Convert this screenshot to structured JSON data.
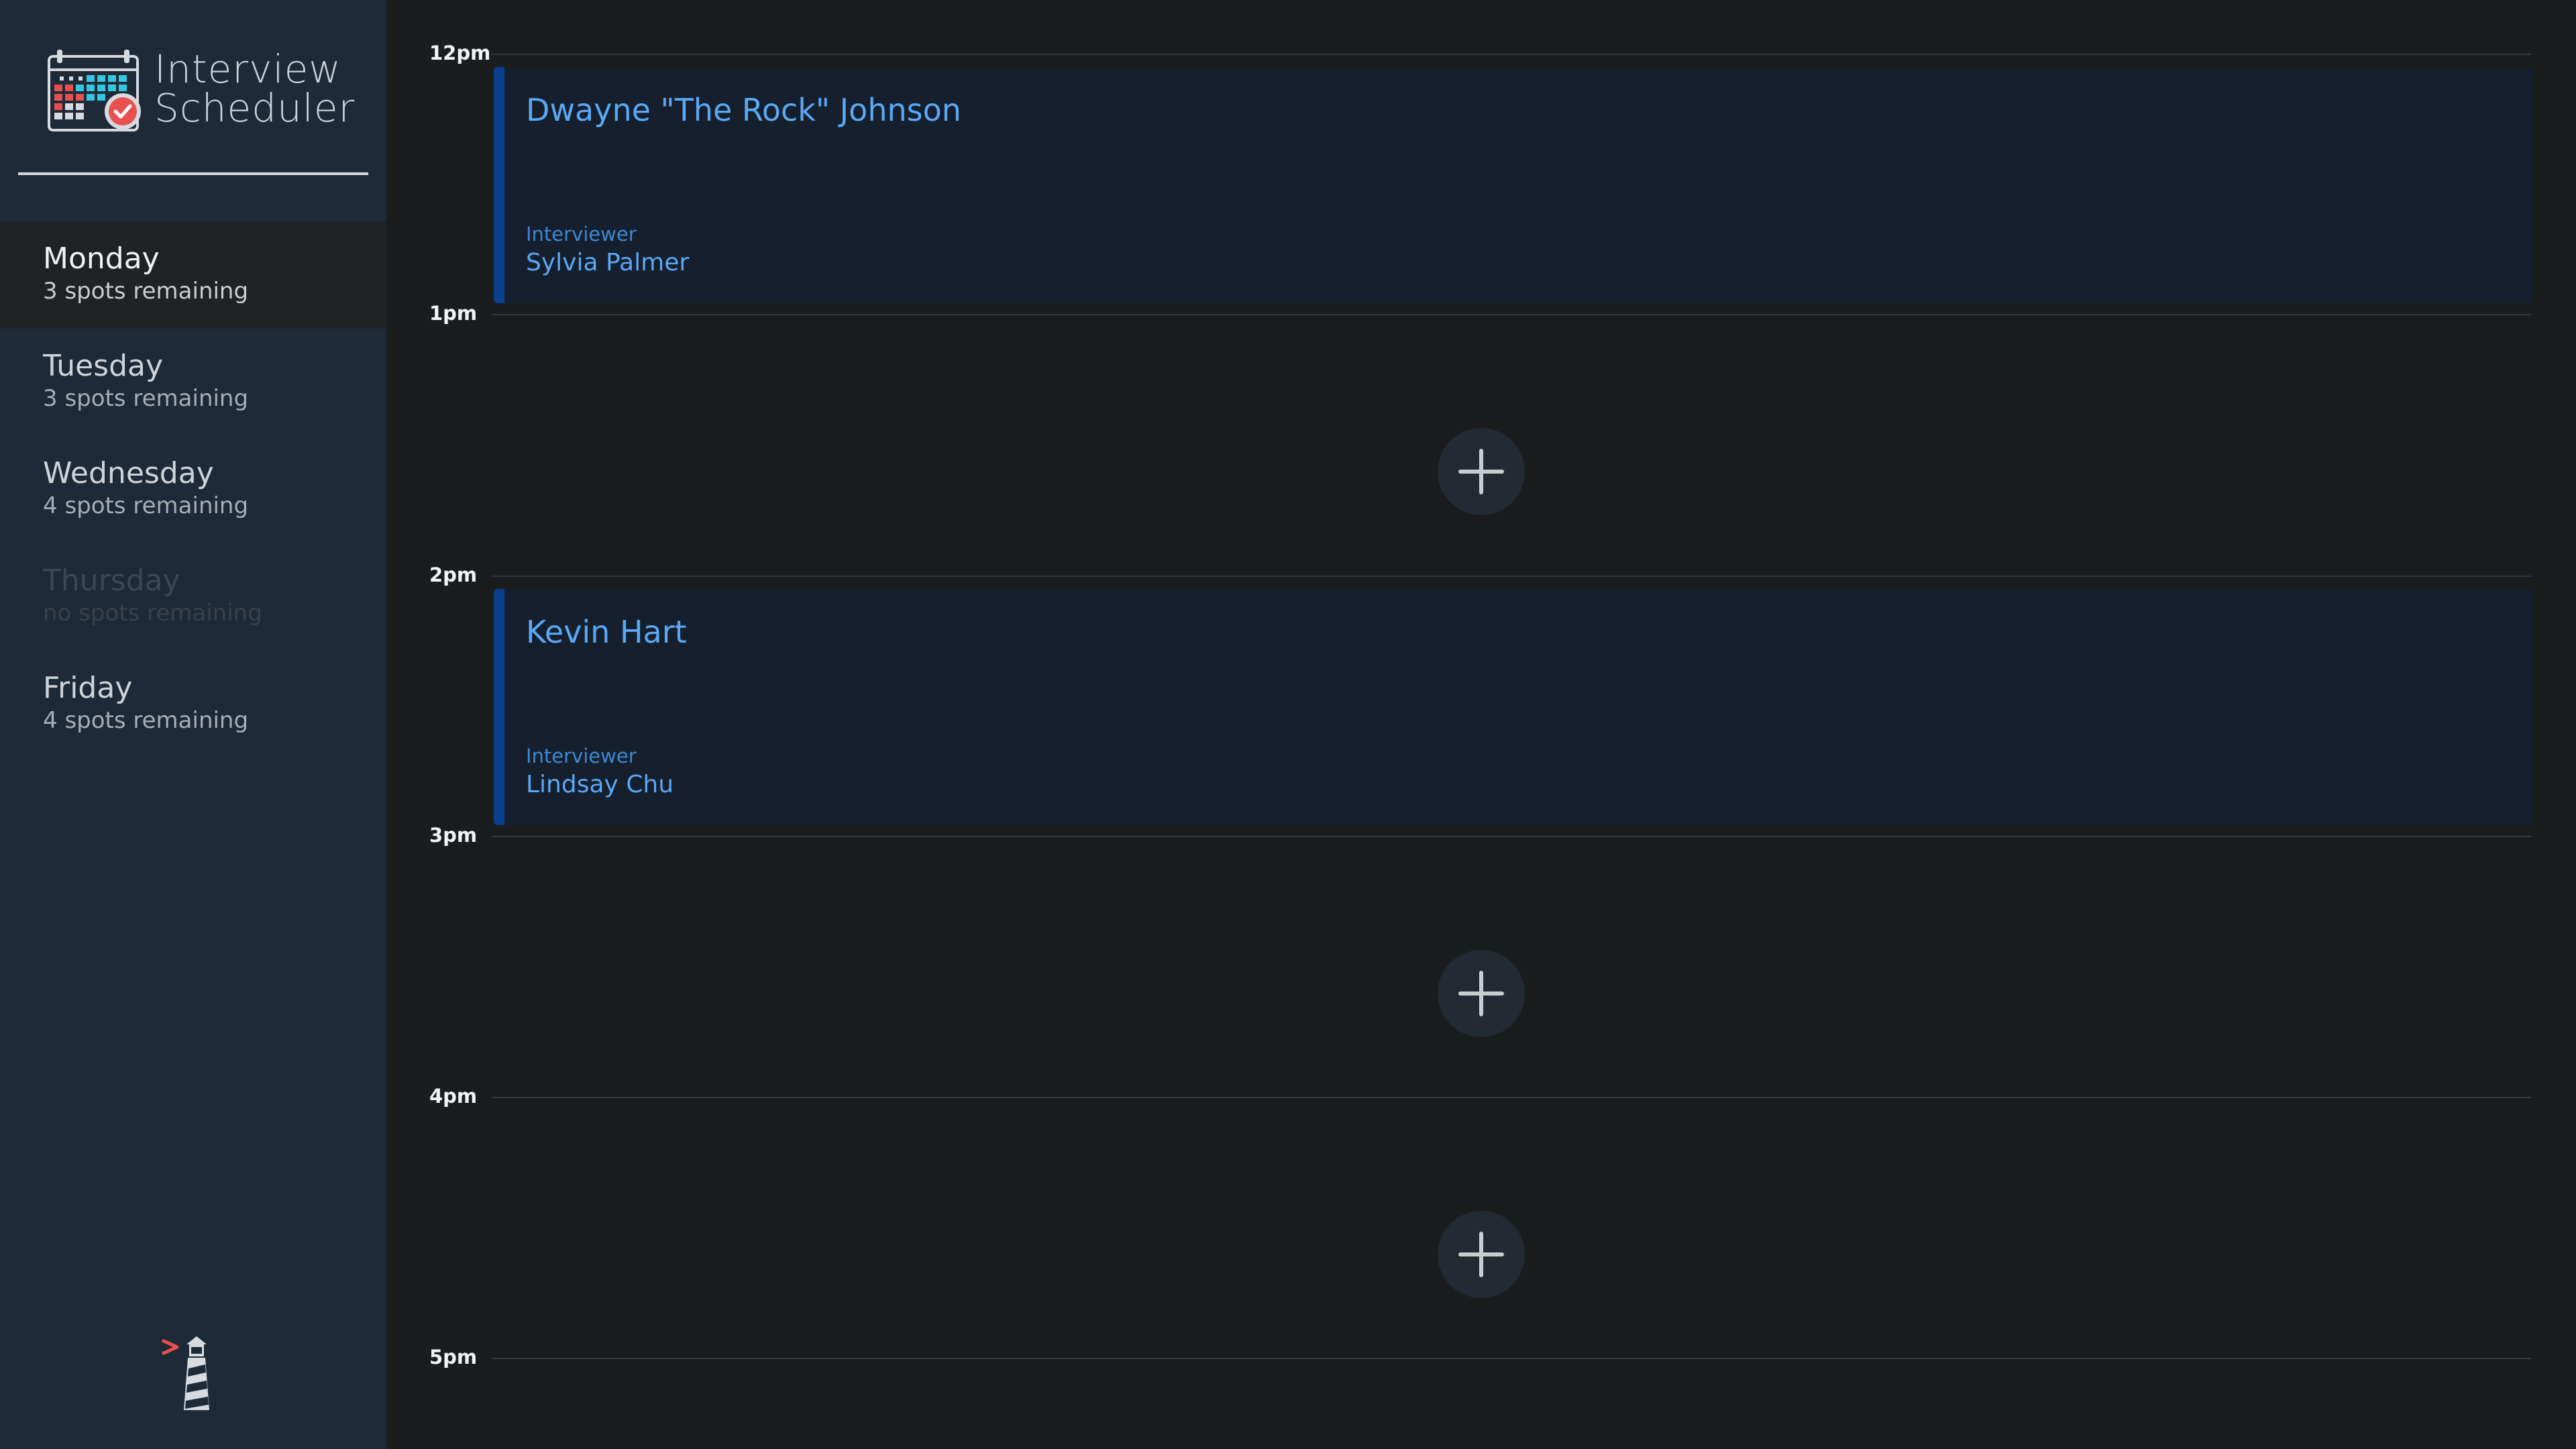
{
  "app": {
    "title_line1": "Interview",
    "title_line2": "Scheduler"
  },
  "days": [
    {
      "name": "Monday",
      "spots": "3 spots remaining",
      "selected": true
    },
    {
      "name": "Tuesday",
      "spots": "3 spots remaining"
    },
    {
      "name": "Wednesday",
      "spots": "4 spots remaining"
    },
    {
      "name": "Thursday",
      "spots": "no spots remaining",
      "full": true
    },
    {
      "name": "Friday",
      "spots": "4 spots remaining"
    }
  ],
  "schedule": {
    "hours": [
      "12pm",
      "1pm",
      "2pm",
      "3pm",
      "4pm",
      "5pm"
    ],
    "appointments": [
      {
        "student": "Dwayne \"The Rock\" Johnson",
        "interviewer_label": "Interviewer",
        "interviewer": "Sylvia Palmer"
      },
      {
        "student": "Kevin Hart",
        "interviewer_label": "Interviewer",
        "interviewer": "Lindsay Chu"
      }
    ]
  },
  "colors": {
    "sidebar_bg": "#1e2a38",
    "main_bg": "#1b1c1d",
    "accent": "#5ba8f5",
    "appointment_border": "#0b3e8f",
    "logo_red": "#e8504f",
    "logo_cyan": "#35c7e0"
  },
  "icons": {
    "brand": "calendar-check-icon",
    "footer": "lighthouse-icon",
    "add": "plus-icon"
  }
}
